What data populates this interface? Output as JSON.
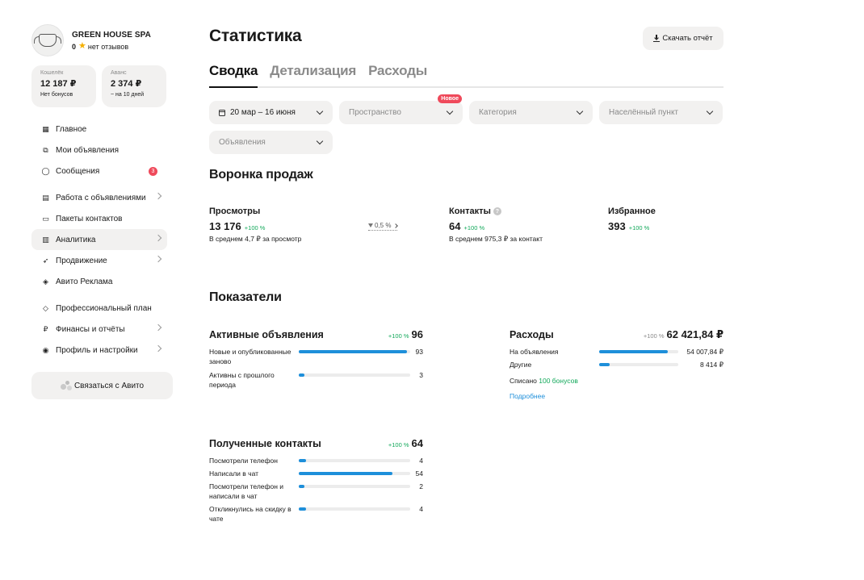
{
  "profile": {
    "name": "GREEN HOUSE SPA",
    "rating": "0",
    "reviews": "нет отзывов"
  },
  "wallet": {
    "label": "Кошелёк",
    "amount": "12 187 ₽",
    "sub": "Нет бонусов"
  },
  "advance": {
    "label": "Аванс",
    "amount": "2 374 ₽",
    "sub": "~ на 10 дней"
  },
  "nav": {
    "items": [
      {
        "label": "Главное"
      },
      {
        "label": "Мои объявления"
      },
      {
        "label": "Сообщения",
        "badge": "3"
      },
      {
        "label": "Работа с объявлениями"
      },
      {
        "label": "Пакеты контактов"
      },
      {
        "label": "Аналитика"
      },
      {
        "label": "Продвижение"
      },
      {
        "label": "Авито Реклама"
      },
      {
        "label": "Профессиональный план"
      },
      {
        "label": "Финансы и отчёты"
      },
      {
        "label": "Профиль и настройки"
      }
    ]
  },
  "contact_button": "Связаться с Авито",
  "page": {
    "title": "Статистика",
    "download_label": "Скачать отчёт"
  },
  "tabs": [
    {
      "label": "Сводка"
    },
    {
      "label": "Детализация"
    },
    {
      "label": "Расходы"
    }
  ],
  "filters": {
    "date": "20 мар – 16 июня",
    "space": "Пространство",
    "space_badge": "Новое",
    "category": "Категория",
    "locality": "Населённый пункт",
    "ads": "Объявления"
  },
  "funnel": {
    "title": "Воронка продаж",
    "views": {
      "label": "Просмотры",
      "value": "13 176",
      "change": "+100 %",
      "sub": "В среднем 4,7 ₽ за просмотр"
    },
    "conversion": "0,5 %",
    "contacts": {
      "label": "Контакты",
      "value": "64",
      "change": "+100 %",
      "sub": "В среднем 975,3 ₽ за контакт"
    },
    "favorites": {
      "label": "Избранное",
      "value": "393",
      "change": "+100 %"
    }
  },
  "indicators": {
    "title": "Показатели",
    "active_ads": {
      "title": "Активные объявления",
      "change": "+100 %",
      "total": "96",
      "rows": [
        {
          "label": "Новые и опубликованные заново",
          "value": "93",
          "fraction": 0.969
        },
        {
          "label": "Активны с прошлого периода",
          "value": "3",
          "fraction": 0.031
        }
      ]
    },
    "expenses": {
      "title": "Расходы",
      "change": "+100 %",
      "total": "62 421,84 ₽",
      "rows": [
        {
          "label": "На объявления",
          "value": "54 007,84 ₽",
          "fraction": 0.865
        },
        {
          "label": "Другие",
          "value": "8 414 ₽",
          "fraction": 0.135
        }
      ],
      "written_off_prefix": "Списано",
      "written_off_value": "100 бонусов",
      "more_link": "Подробнее"
    },
    "received_contacts": {
      "title": "Полученные контакты",
      "change": "+100 %",
      "total": "64",
      "rows": [
        {
          "label": "Посмотрели телефон",
          "value": "4",
          "fraction": 0.0625
        },
        {
          "label": "Написали в чат",
          "value": "54",
          "fraction": 0.844
        },
        {
          "label": "Посмотрели телефон и написали в чат",
          "value": "2",
          "fraction": 0.031
        },
        {
          "label": "Откликнулись на скидку в чате",
          "value": "4",
          "fraction": 0.0625
        }
      ]
    }
  },
  "colors": {
    "accent_blue": "#1e8fda",
    "positive_green": "#12a85a",
    "badge_red": "#ef4a5b"
  }
}
